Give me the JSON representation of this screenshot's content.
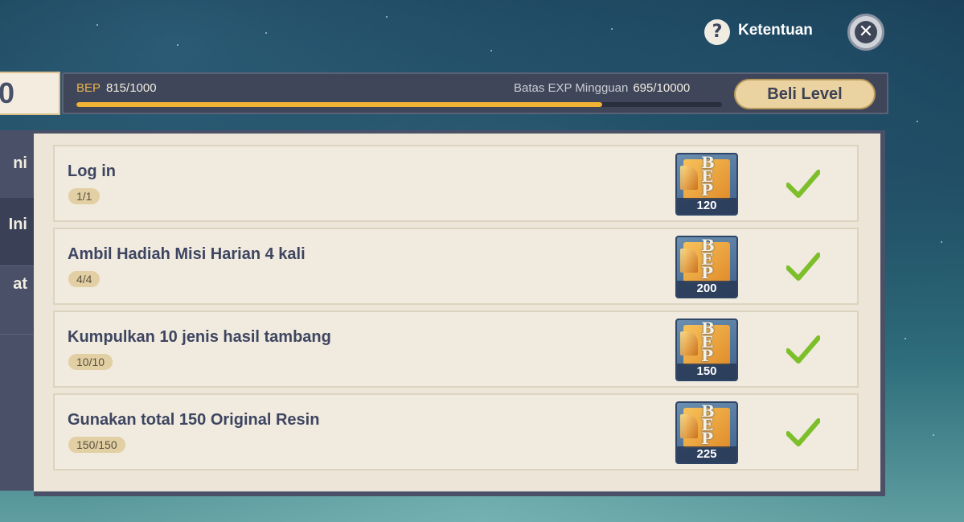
{
  "header": {
    "help_label": "Ketentuan",
    "help_icon": "question-icon",
    "close_icon": "close-icon"
  },
  "level": {
    "value": "0"
  },
  "exp": {
    "bep_label": "BEP",
    "bep_value": "815/1000",
    "bep_fraction": 0.815,
    "weekly_label": "Batas EXP Mingguan",
    "weekly_value": "695/10000",
    "buy_label": "Beli Level",
    "bar_color": "#f2b233"
  },
  "sidebar": {
    "items": [
      {
        "label": "ni"
      },
      {
        "label": "Ini"
      },
      {
        "label": "at"
      }
    ]
  },
  "tasks": [
    {
      "title": "Log in",
      "progress": "1/1",
      "reward": "120"
    },
    {
      "title": "Ambil Hadiah Misi Harian 4 kali",
      "progress": "4/4",
      "reward": "200"
    },
    {
      "title": "Kumpulkan 10 jenis hasil tambang",
      "progress": "10/10",
      "reward": "150"
    },
    {
      "title": "Gunakan total 150 Original Resin",
      "progress": "150/150",
      "reward": "225"
    }
  ],
  "colors": {
    "accent": "#f2b233",
    "check": "#7cbf2a",
    "panel": "#ece5d8"
  }
}
